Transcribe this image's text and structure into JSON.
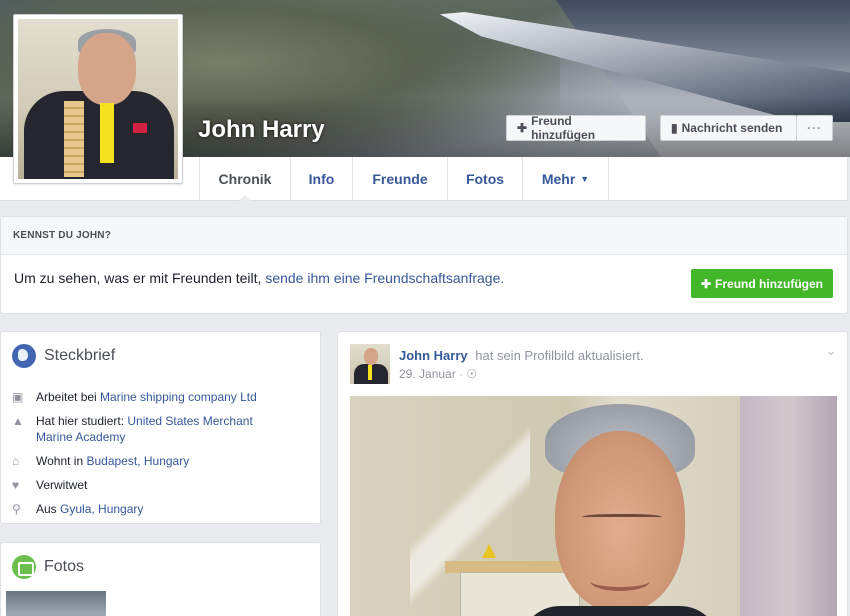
{
  "profile": {
    "name": "John Harry"
  },
  "cover_actions": {
    "add_friend": "Freund hinzufügen",
    "send_message": "Nachricht senden",
    "more": "···"
  },
  "tabs": [
    {
      "label": "Chronik"
    },
    {
      "label": "Info"
    },
    {
      "label": "Freunde"
    },
    {
      "label": "Fotos"
    },
    {
      "label": "Mehr"
    }
  ],
  "know_box": {
    "heading": "KENNST DU JOHN?",
    "text": "Um zu sehen, was er mit Freunden teilt,",
    "link": "sende ihm eine Freundschaftsanfrage.",
    "button": "Freund hinzufügen"
  },
  "intro": {
    "title": "Steckbrief",
    "items": [
      {
        "icon": "briefcase-icon",
        "prefix": "Arbeitet bei ",
        "link": "Marine shipping company Ltd"
      },
      {
        "icon": "graduation-cap-icon",
        "prefix": "Hat hier studiert: ",
        "link": "United States Merchant Marine Academy"
      },
      {
        "icon": "home-icon",
        "prefix": "Wohnt in ",
        "link": "Budapest, Hungary"
      },
      {
        "icon": "heart-icon",
        "prefix": "Verwitwet",
        "link": ""
      },
      {
        "icon": "location-pin-icon",
        "prefix": "Aus ",
        "link": "Gyula, Hungary"
      }
    ]
  },
  "photos_card": {
    "title": "Fotos"
  },
  "post": {
    "author": "John Harry",
    "action": "hat sein Profilbild aktualisiert.",
    "date": "29. Januar",
    "separator": "·"
  },
  "colors": {
    "link": "#365899",
    "green_button": "#42b72a",
    "page_bg": "#e9ebee"
  }
}
